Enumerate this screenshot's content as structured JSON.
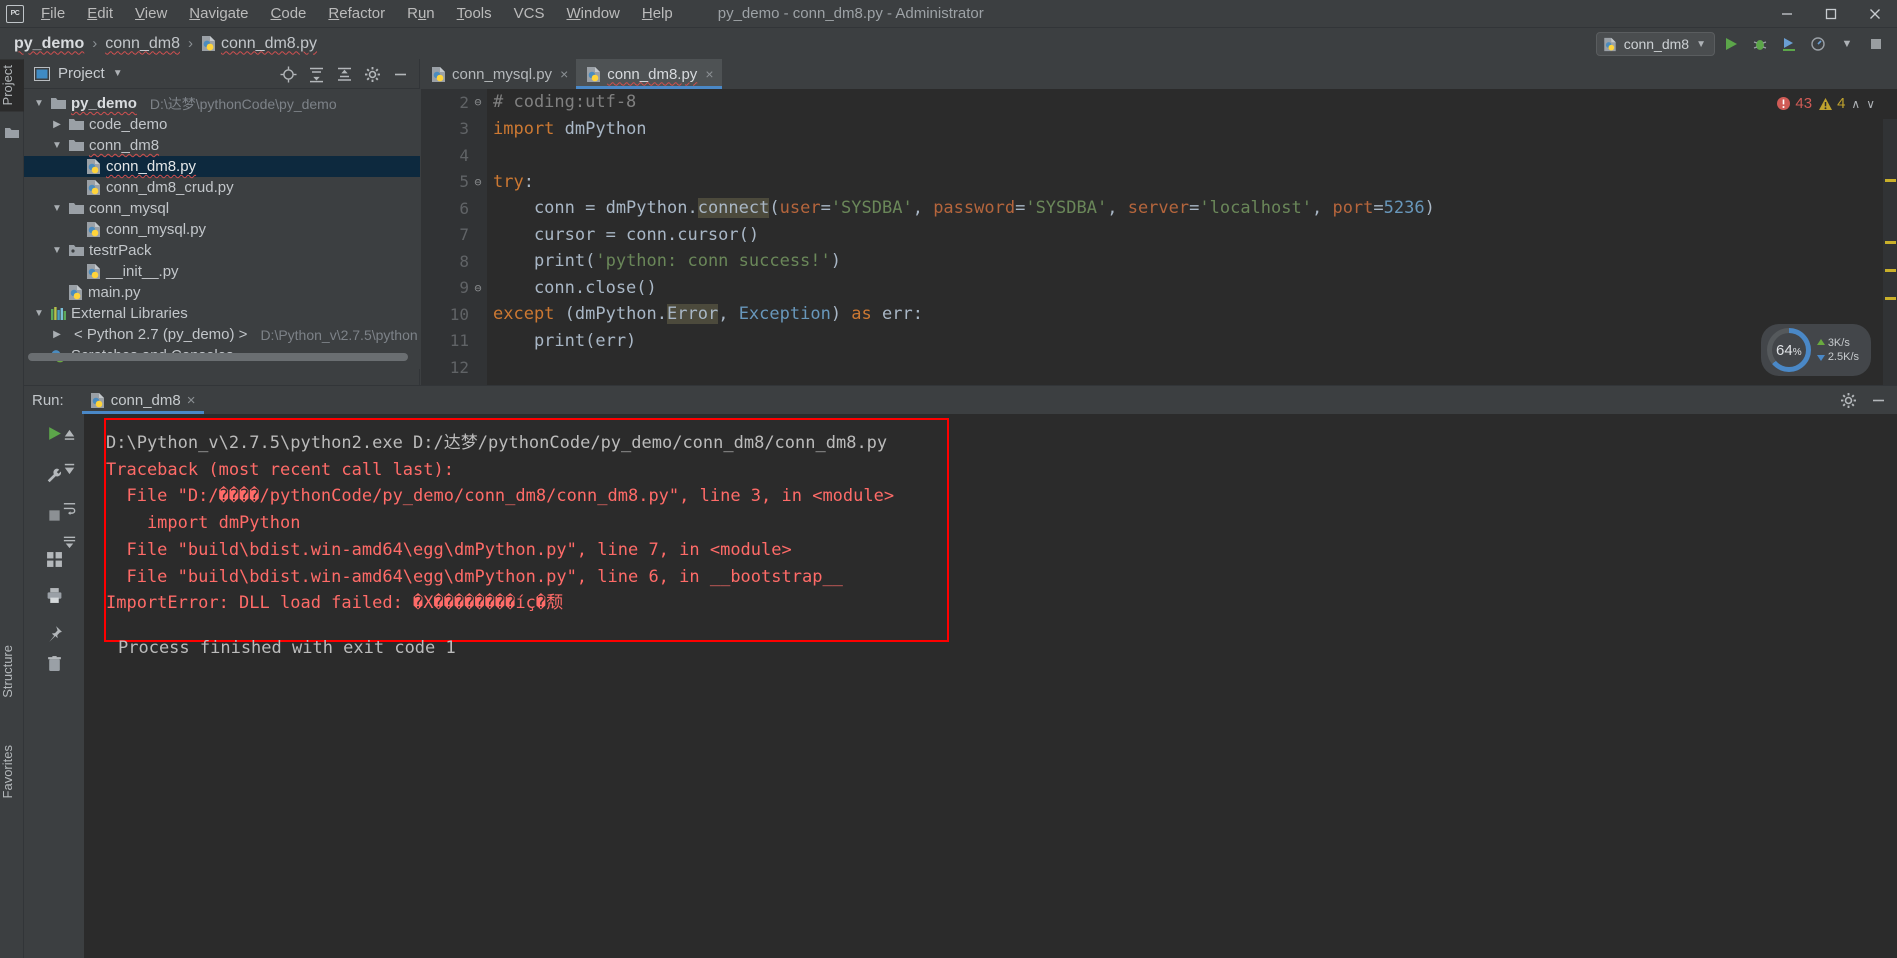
{
  "window": {
    "title": "py_demo - conn_dm8.py - Administrator",
    "logo_text": "PC"
  },
  "menu": {
    "items": [
      {
        "label": "File",
        "mnemonic": "F"
      },
      {
        "label": "Edit",
        "mnemonic": "E"
      },
      {
        "label": "View",
        "mnemonic": "V"
      },
      {
        "label": "Navigate",
        "mnemonic": "N"
      },
      {
        "label": "Code",
        "mnemonic": "C"
      },
      {
        "label": "Refactor",
        "mnemonic": "R"
      },
      {
        "label": "Run",
        "mnemonic": "u"
      },
      {
        "label": "Tools",
        "mnemonic": "T"
      },
      {
        "label": "VCS",
        "mnemonic": ""
      },
      {
        "label": "Window",
        "mnemonic": "W"
      },
      {
        "label": "Help",
        "mnemonic": "H"
      }
    ]
  },
  "window_controls": {
    "minimize": "minimize-icon",
    "maximize": "maximize-icon",
    "close": "close-icon"
  },
  "breadcrumb": {
    "items": [
      "py_demo",
      "conn_dm8",
      "conn_dm8.py"
    ],
    "separator": "›"
  },
  "toolbar": {
    "run_config": "conn_dm8",
    "run_config_dropdown": "chevron-down-icon",
    "buttons": [
      {
        "name": "run-button",
        "glyph": "▶",
        "color": "#5ca64a"
      },
      {
        "name": "debug-button",
        "glyph": "bug",
        "color": "#a9b7c6"
      },
      {
        "name": "run-coverage-button",
        "glyph": "coverage",
        "color": "#a9b7c6"
      },
      {
        "name": "profile-button",
        "glyph": "profile",
        "color": "#a9b7c6"
      },
      {
        "name": "more-dropdown-button",
        "glyph": "▾",
        "color": "#a9b7c6"
      },
      {
        "name": "stop-button",
        "glyph": "■",
        "color": "#9a9ea1"
      }
    ]
  },
  "left_strip": {
    "tabs": [
      {
        "label": "Project",
        "selected": true
      },
      {
        "label": "Structure",
        "selected": false
      },
      {
        "label": "Favorites",
        "selected": false
      }
    ]
  },
  "project_panel": {
    "title": "Project",
    "dropdown_icon": "chevron-down-icon",
    "actions": [
      {
        "name": "locate-icon",
        "title": "Select Opened File"
      },
      {
        "name": "expand-all-icon",
        "title": "Expand All"
      },
      {
        "name": "collapse-all-icon",
        "title": "Collapse All"
      },
      {
        "name": "gear-icon",
        "title": "Settings"
      },
      {
        "name": "hide-icon",
        "title": "Hide"
      }
    ],
    "tree": [
      {
        "label": "py_demo",
        "path": "D:\\达梦\\pythonCode\\py_demo",
        "icon": "folder-icon",
        "indent": 0,
        "arrow": "down",
        "bold": true,
        "selected": false
      },
      {
        "label": "code_demo",
        "path": "",
        "icon": "folder-icon",
        "indent": 1,
        "arrow": "right",
        "bold": false,
        "selected": false
      },
      {
        "label": "conn_dm8",
        "path": "",
        "icon": "folder-icon",
        "indent": 1,
        "arrow": "down",
        "bold": false,
        "selected": false
      },
      {
        "label": "conn_dm8.py",
        "path": "",
        "icon": "python-file-icon",
        "indent": 2,
        "arrow": "none",
        "bold": false,
        "selected": true
      },
      {
        "label": "conn_dm8_crud.py",
        "path": "",
        "icon": "python-file-icon",
        "indent": 2,
        "arrow": "none",
        "bold": false,
        "selected": false
      },
      {
        "label": "conn_mysql",
        "path": "",
        "icon": "folder-icon",
        "indent": 1,
        "arrow": "down",
        "bold": false,
        "selected": false
      },
      {
        "label": "conn_mysql.py",
        "path": "",
        "icon": "python-file-icon",
        "indent": 2,
        "arrow": "none",
        "bold": false,
        "selected": false
      },
      {
        "label": "testrPack",
        "path": "",
        "icon": "package-icon",
        "indent": 1,
        "arrow": "down",
        "bold": false,
        "selected": false
      },
      {
        "label": "__init__.py",
        "path": "",
        "icon": "python-file-icon",
        "indent": 2,
        "arrow": "none",
        "bold": false,
        "selected": false
      },
      {
        "label": "main.py",
        "path": "",
        "icon": "python-file-icon",
        "indent": 1,
        "arrow": "none",
        "bold": false,
        "selected": false
      },
      {
        "label": "External Libraries",
        "path": "",
        "icon": "library-icon",
        "indent": 0,
        "arrow": "down",
        "bold": false,
        "selected": false
      },
      {
        "label": "< Python 2.7 (py_demo) >",
        "path": "D:\\Python_v\\2.7.5\\python",
        "icon": "python-interpreter-icon",
        "indent": 1,
        "arrow": "right",
        "bold": false,
        "selected": false
      },
      {
        "label": "Scratches and Consoles",
        "path": "",
        "icon": "scratch-icon",
        "indent": 0,
        "arrow": "none",
        "bold": false,
        "selected": false
      }
    ]
  },
  "editor": {
    "tabs": [
      {
        "label": "conn_mysql.py",
        "active": false,
        "close": "×"
      },
      {
        "label": "conn_dm8.py",
        "active": true,
        "close": "×"
      }
    ],
    "inspection": {
      "errors": "43",
      "warnings": "4",
      "error_icon": "error-circle-icon",
      "warning_icon": "warning-triangle-icon",
      "up_arrow": "∧",
      "down_arrow": "∨"
    },
    "first_visible_line": 2,
    "lines": [
      {
        "no": "2",
        "fold": "⊖",
        "tokens": [
          {
            "t": "# coding:utf-8",
            "c": "c-com"
          }
        ]
      },
      {
        "no": "3",
        "fold": "",
        "tokens": [
          {
            "t": "import ",
            "c": "c-kw"
          },
          {
            "t": "dmPython",
            "c": "c-def"
          }
        ]
      },
      {
        "no": "4",
        "fold": "",
        "tokens": []
      },
      {
        "no": "5",
        "fold": "⊖",
        "tokens": [
          {
            "t": "try",
            "c": "c-kw"
          },
          {
            "t": ":",
            "c": "c-def"
          }
        ]
      },
      {
        "no": "6",
        "fold": "",
        "tokens": [
          {
            "t": "    conn = dmPython.",
            "c": "c-def"
          },
          {
            "t": "connect",
            "c": "c-def hl"
          },
          {
            "t": "(",
            "c": "c-def"
          },
          {
            "t": "user",
            "c": "c-par"
          },
          {
            "t": "=",
            "c": "c-def"
          },
          {
            "t": "'SYSDBA'",
            "c": "c-str"
          },
          {
            "t": ", ",
            "c": "c-def"
          },
          {
            "t": "password",
            "c": "c-par"
          },
          {
            "t": "=",
            "c": "c-def"
          },
          {
            "t": "'SYSDBA'",
            "c": "c-str"
          },
          {
            "t": ", ",
            "c": "c-def"
          },
          {
            "t": "server",
            "c": "c-par"
          },
          {
            "t": "=",
            "c": "c-def"
          },
          {
            "t": "'localhost'",
            "c": "c-str"
          },
          {
            "t": ", ",
            "c": "c-def"
          },
          {
            "t": "port",
            "c": "c-par"
          },
          {
            "t": "=",
            "c": "c-def"
          },
          {
            "t": "5236",
            "c": "c-num"
          },
          {
            "t": ")",
            "c": "c-def"
          }
        ]
      },
      {
        "no": "7",
        "fold": "",
        "tokens": [
          {
            "t": "    cursor = conn.cursor()",
            "c": "c-def"
          }
        ]
      },
      {
        "no": "8",
        "fold": "",
        "tokens": [
          {
            "t": "    print(",
            "c": "c-def"
          },
          {
            "t": "'python: conn success!'",
            "c": "c-str"
          },
          {
            "t": ")",
            "c": "c-def"
          }
        ]
      },
      {
        "no": "9",
        "fold": "⊖",
        "tokens": [
          {
            "t": "    conn.close()",
            "c": "c-def"
          }
        ]
      },
      {
        "no": "10",
        "fold": "",
        "tokens": [
          {
            "t": "except",
            "c": "c-kw"
          },
          {
            "t": " (dmPython.",
            "c": "c-def"
          },
          {
            "t": "Error",
            "c": "c-def hl"
          },
          {
            "t": ", ",
            "c": "c-def"
          },
          {
            "t": "Exception",
            "c": "c-num"
          },
          {
            "t": ") ",
            "c": "c-def"
          },
          {
            "t": "as",
            "c": "c-kw"
          },
          {
            "t": " err:",
            "c": "c-def"
          }
        ]
      },
      {
        "no": "11",
        "fold": "",
        "tokens": [
          {
            "t": "    print(err)",
            "c": "c-def"
          }
        ]
      },
      {
        "no": "12",
        "fold": "",
        "tokens": []
      }
    ]
  },
  "memory_widget": {
    "percent": "64",
    "percent_unit": "%",
    "up_rate": "3K/s",
    "down_rate": "2.5K/s",
    "up_icon": "arrow-up-icon",
    "down_icon": "arrow-down-icon"
  },
  "run_panel": {
    "label": "Run:",
    "tab": "conn_dm8",
    "tab_close": "×",
    "tab_icon": "python-file-icon",
    "header_actions": [
      {
        "name": "gear-icon"
      },
      {
        "name": "hide-icon"
      }
    ],
    "side_buttons": [
      {
        "name": "rerun-button",
        "glyph": "▶",
        "color": "#5ca64a"
      },
      {
        "name": "settings-wrench-button",
        "glyph": "wrench",
        "color": "#a9b7c6"
      },
      {
        "name": "stop-button",
        "glyph": "■",
        "color": "#9a9ea1"
      },
      {
        "name": "print-button",
        "glyph": "printer",
        "color": "#a9b7c6"
      },
      {
        "name": "layout-button",
        "glyph": "grid",
        "color": "#a9b7c6"
      },
      {
        "name": "pin-button",
        "glyph": "pin",
        "color": "#a9b7c6"
      },
      {
        "name": "clear-all-button",
        "glyph": "trash",
        "color": "#a9b7c6"
      }
    ],
    "side_buttons2": [
      {
        "name": "scroll-up-button",
        "glyph": "↑"
      },
      {
        "name": "scroll-down-button",
        "glyph": "↓"
      },
      {
        "name": "soft-wrap-button",
        "glyph": "wrap"
      },
      {
        "name": "scroll-to-end-button",
        "glyph": "end"
      }
    ],
    "console_lines": [
      {
        "text": "D:\\Python_v\\2.7.5\\python2.exe D:/达梦/pythonCode/py_demo/conn_dm8/conn_dm8.py",
        "color": "c-white"
      },
      {
        "text": "Traceback (most recent call last):",
        "color": "c-red"
      },
      {
        "text": "  File \"D:/����/pythonCode/py_demo/conn_dm8/conn_dm8.py\", line 3, in <module>",
        "color": "c-red"
      },
      {
        "text": "    import dmPython",
        "color": "c-red"
      },
      {
        "text": "  File \"build\\bdist.win-amd64\\egg\\dmPython.py\", line 7, in <module>",
        "color": "c-red"
      },
      {
        "text": "  File \"build\\bdist.win-amd64\\egg\\dmPython.py\", line 6, in __bootstrap__",
        "color": "c-red"
      },
      {
        "text": "ImportError: DLL load failed: �X��������íç�颓",
        "color": "c-red"
      }
    ],
    "exit_line": "Process finished with exit code 1",
    "highlight_box_color": "#ff0000"
  },
  "colors": {
    "accent": "#4a88c7",
    "panel_bg": "#3c3f41",
    "editor_bg": "#2b2b2b",
    "selection": "#0d293e",
    "error_red": "#ff6b68",
    "box_red": "#ff0000"
  }
}
